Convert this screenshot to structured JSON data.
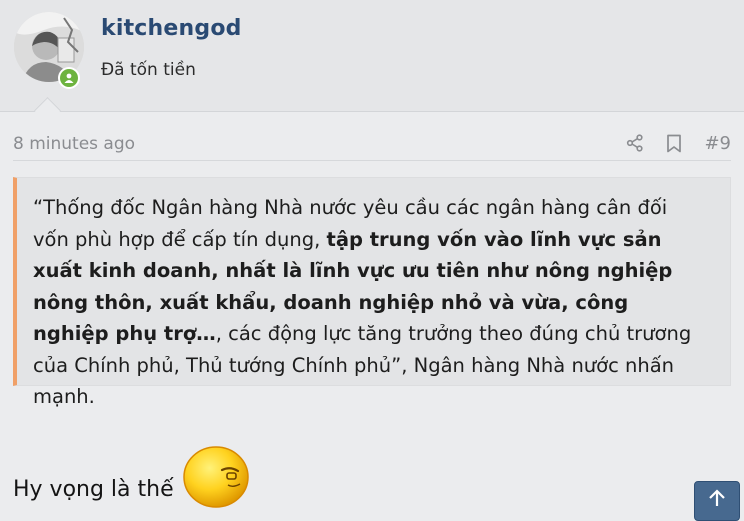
{
  "user": {
    "username": "kitchengod",
    "title": "Đã tốn tiền",
    "status": "online"
  },
  "post": {
    "time": "8 minutes ago",
    "number": "#9",
    "actions": [
      "share-icon",
      "bookmark-icon"
    ]
  },
  "quote": {
    "part1": "“Thống đốc Ngân hàng Nhà nước yêu cầu các ngân hàng cân đối vốn phù hợp để cấp tín dụng, ",
    "bold": "tập trung vốn vào lĩnh vực sản xuất kinh doanh, nhất là lĩnh vực ưu tiên như nông nghiệp nông thôn, xuất khẩu, doanh nghiệp nhỏ và vừa, công nghiệp phụ trợ…",
    "part2": ", các động lực tăng trưởng theo đúng chủ trương của Chính phủ, Thủ tướng Chính phủ”, Ngân hàng Nhà nước nhấn mạnh."
  },
  "reply": {
    "text": "Hy vọng là thế",
    "emoji": "yellow-face-emoji"
  },
  "colors": {
    "username": "#2a4a73",
    "quote_border": "#f0a068",
    "online": "#6db33f",
    "scroll_button": "#47698f"
  }
}
